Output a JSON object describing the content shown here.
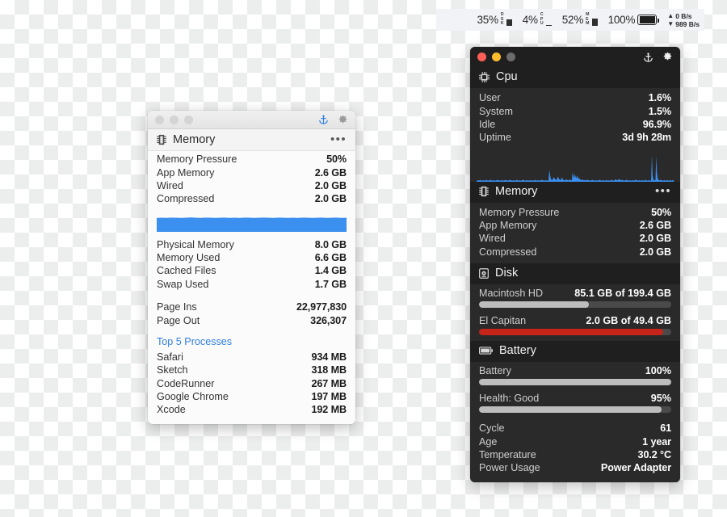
{
  "menubar": {
    "items": [
      {
        "name": "disk-usage",
        "percent": "35%",
        "label": "DSK",
        "bar_fill": 0.55,
        "icon": "bar-indicator"
      },
      {
        "name": "cpu-usage",
        "percent": "4%",
        "label": "CPU",
        "bar_fill": 0.08,
        "icon": "bar-indicator"
      },
      {
        "name": "memory-usage",
        "percent": "52%",
        "label": "MEM",
        "bar_fill": 0.62,
        "icon": "bar-indicator"
      },
      {
        "name": "battery",
        "percent": "100%",
        "label": "",
        "icon": "battery-charging-icon"
      }
    ],
    "network": {
      "up": "0 B/s",
      "down": "989 B/s",
      "up_icon": "arrow-up-icon",
      "down_icon": "arrow-down-icon"
    }
  },
  "light_window": {
    "traffic_lights": [
      "close",
      "minimize",
      "zoom"
    ],
    "anchor_icon": "anchor-icon",
    "gear_icon": "gear-icon",
    "accent_color": "#2f7fe0",
    "section": {
      "icon": "memory-chip-icon",
      "title": "Memory",
      "overflow": "•••"
    },
    "stats_top": [
      {
        "key": "Memory Pressure",
        "value": "50%"
      },
      {
        "key": "App Memory",
        "value": "2.6 GB"
      },
      {
        "key": "Wired",
        "value": "2.0 GB"
      },
      {
        "key": "Compressed",
        "value": "2.0 GB"
      }
    ],
    "graph": {
      "type": "area",
      "color": "#3b8fef",
      "label": "memory-pressure-history",
      "values": [
        96,
        97,
        96,
        98,
        97,
        96,
        97,
        99,
        97,
        96,
        98,
        97,
        96,
        97,
        98,
        96,
        97,
        96,
        98,
        97,
        96,
        97,
        98,
        97,
        96,
        98,
        97,
        96,
        97,
        96,
        98,
        97,
        96,
        97,
        98,
        96,
        97,
        98,
        96,
        97
      ]
    },
    "stats_mid": [
      {
        "key": "Physical Memory",
        "value": "8.0 GB"
      },
      {
        "key": "Memory Used",
        "value": "6.6 GB"
      },
      {
        "key": "Cached Files",
        "value": "1.4 GB"
      },
      {
        "key": "Swap Used",
        "value": "1.7 GB"
      }
    ],
    "stats_pages": [
      {
        "key": "Page Ins",
        "value": "22,977,830"
      },
      {
        "key": "Page Out",
        "value": "326,307"
      }
    ],
    "top_processes_title": "Top 5 Processes",
    "top_processes": [
      {
        "key": "Safari",
        "value": "934 MB"
      },
      {
        "key": "Sketch",
        "value": "318 MB"
      },
      {
        "key": "CodeRunner",
        "value": "267 MB"
      },
      {
        "key": "Google Chrome",
        "value": "197 MB"
      },
      {
        "key": "Xcode",
        "value": "192 MB"
      }
    ]
  },
  "dark_window": {
    "traffic_lights": [
      {
        "name": "close",
        "color": "#ff5f57"
      },
      {
        "name": "minimize",
        "color": "#febc2e"
      },
      {
        "name": "zoom",
        "color": "#6b6b6b"
      }
    ],
    "anchor_icon": "anchor-icon",
    "gear_icon": "gear-icon",
    "cpu": {
      "icon": "cpu-chip-icon",
      "title": "Cpu",
      "stats": [
        {
          "key": "User",
          "value": "1.6%"
        },
        {
          "key": "System",
          "value": "1.5%"
        },
        {
          "key": "Idle",
          "value": "96.9%"
        },
        {
          "key": "Uptime",
          "value": "3d 9h 28m"
        }
      ],
      "graph": {
        "type": "area",
        "color": "#3b8fef",
        "label": "cpu-history",
        "values": [
          4,
          3,
          4,
          5,
          4,
          6,
          4,
          3,
          4,
          5,
          4,
          3,
          4,
          6,
          5,
          4,
          3,
          4,
          5,
          6,
          5,
          4,
          3,
          4,
          5,
          4,
          3,
          4,
          6,
          5,
          4,
          5,
          4,
          3,
          4,
          5,
          4,
          3,
          5,
          4,
          6,
          5,
          4,
          3,
          4,
          5,
          6,
          5,
          4,
          3,
          4,
          5,
          4,
          3,
          4,
          6,
          5,
          4,
          3,
          5,
          4,
          3,
          4,
          5,
          6,
          5,
          4,
          3,
          4,
          5,
          4,
          3,
          4,
          5,
          4,
          3,
          5,
          4,
          3,
          4,
          6,
          5,
          4,
          3,
          4,
          5,
          4,
          3,
          4,
          5,
          6,
          5,
          4,
          3,
          4,
          5,
          4,
          3,
          4,
          5,
          38,
          22,
          10,
          6,
          5,
          9,
          14,
          11,
          8,
          6,
          5,
          12,
          16,
          10,
          7,
          5,
          6,
          14,
          9,
          7,
          5,
          4,
          5,
          8,
          6,
          5,
          4,
          5,
          7,
          6,
          5,
          4,
          30,
          18,
          12,
          24,
          16,
          10,
          20,
          14,
          9,
          12,
          8,
          6,
          5,
          7,
          6,
          5,
          4,
          6,
          5,
          4,
          5,
          6,
          5,
          4,
          3,
          4,
          5,
          6,
          5,
          4,
          3,
          4,
          5,
          4,
          3,
          4,
          5,
          6,
          5,
          4,
          3,
          4,
          5,
          4,
          3,
          4,
          5,
          4,
          3,
          5,
          4,
          3,
          4,
          5,
          6,
          4,
          3,
          4,
          5,
          8,
          6,
          5,
          4,
          7,
          9,
          6,
          5,
          4,
          6,
          5,
          4,
          3,
          4,
          5,
          6,
          5,
          4,
          3,
          5,
          4,
          3,
          4,
          5,
          4,
          3,
          4,
          5,
          6,
          5,
          4,
          3,
          4,
          5,
          4,
          3,
          4,
          5,
          4,
          3,
          4,
          6,
          5,
          4,
          3,
          4,
          5,
          4,
          3,
          4,
          82,
          20,
          8,
          5,
          4,
          6,
          78,
          30,
          10,
          6,
          5,
          4,
          6,
          5,
          4,
          3,
          4,
          5,
          4,
          3,
          4,
          5,
          4,
          3,
          4,
          5,
          4,
          3,
          4,
          5,
          4
        ]
      }
    },
    "memory": {
      "icon": "memory-chip-icon",
      "title": "Memory",
      "overflow": "•••",
      "stats": [
        {
          "key": "Memory Pressure",
          "value": "50%"
        },
        {
          "key": "App Memory",
          "value": "2.6 GB"
        },
        {
          "key": "Wired",
          "value": "2.0 GB"
        },
        {
          "key": "Compressed",
          "value": "2.0 GB"
        }
      ]
    },
    "disk": {
      "icon": "disk-icon",
      "title": "Disk",
      "volumes": [
        {
          "key": "Macintosh HD",
          "value": "85.1 GB of 199.4 GB",
          "fill_pct": 57,
          "color": "#bdbdbd"
        },
        {
          "key": "El Capitan",
          "value": "2.0 GB of 49.4 GB",
          "fill_pct": 96,
          "color": "#c62418"
        }
      ]
    },
    "battery": {
      "icon": "battery-icon",
      "title": "Battery",
      "meters": [
        {
          "key": "Battery",
          "value": "100%",
          "fill_pct": 100,
          "color": "#bdbdbd"
        },
        {
          "key": "Health: Good",
          "value": "95%",
          "fill_pct": 95,
          "color": "#bdbdbd"
        }
      ],
      "stats": [
        {
          "key": "Cycle",
          "value": "61"
        },
        {
          "key": "Age",
          "value": "1 year"
        },
        {
          "key": "Temperature",
          "value": "30.2 °C"
        },
        {
          "key": "Power Usage",
          "value": "Power Adapter"
        }
      ]
    }
  }
}
